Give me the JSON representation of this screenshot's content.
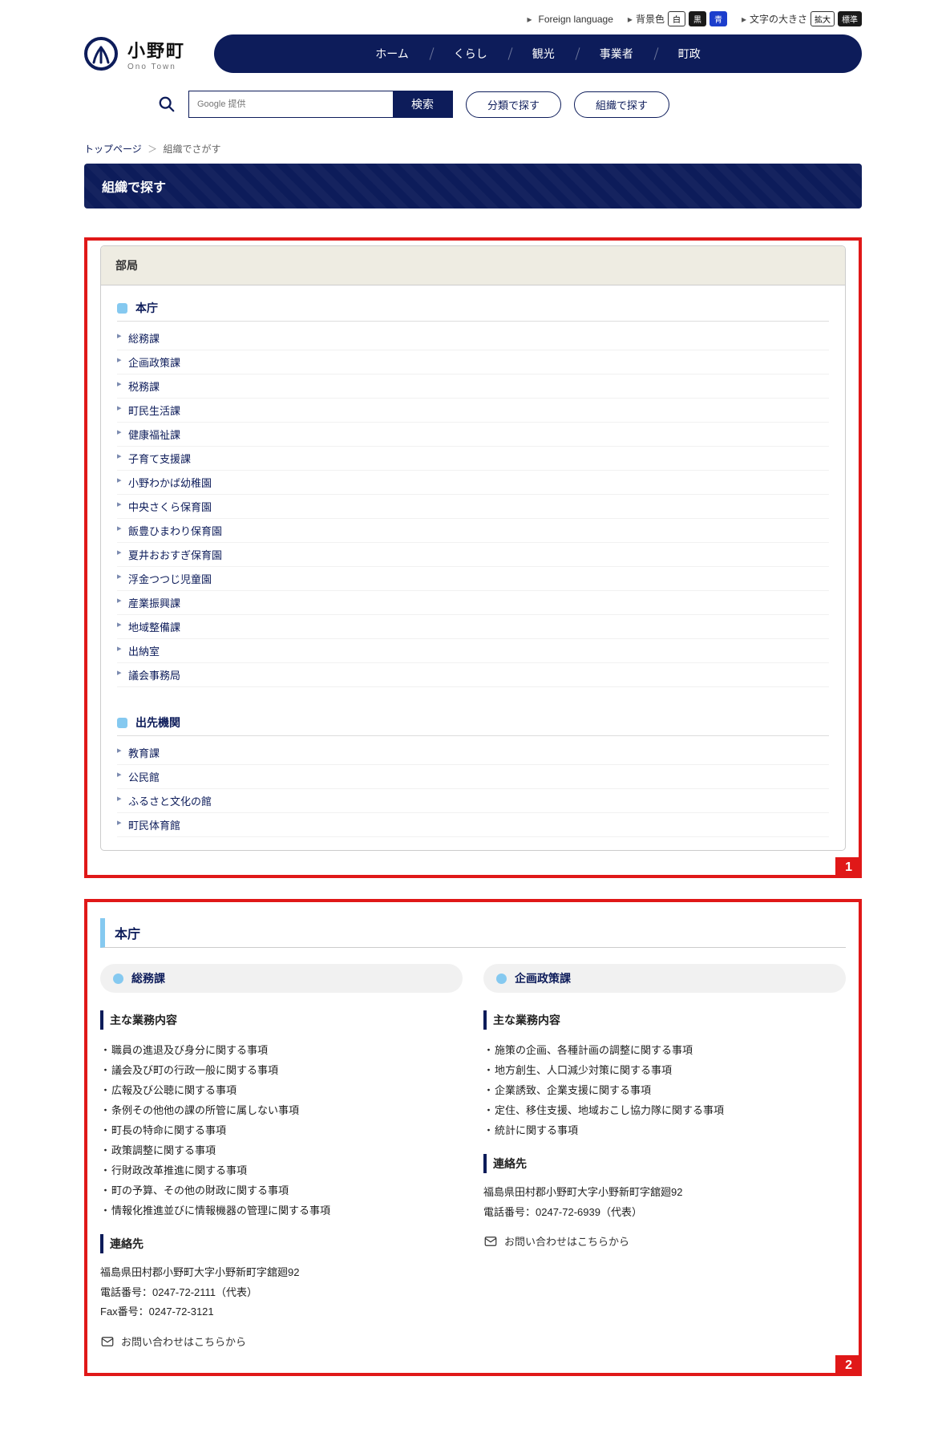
{
  "topbar": {
    "foreign": "Foreign language",
    "bgcolor_label": "背景色",
    "bg_white": "白",
    "bg_black": "黒",
    "bg_blue": "青",
    "fontsize_label": "文字の大きさ",
    "font_large": "拡大",
    "font_std": "標準"
  },
  "logo": {
    "jp": "小野町",
    "en": "Ono Town"
  },
  "nav": [
    "ホーム",
    "くらし",
    "観光",
    "事業者",
    "町政"
  ],
  "search": {
    "placeholder": "Google 提供",
    "button": "検索",
    "by_category": "分類で探す",
    "by_org": "組織で探す"
  },
  "crumbs": {
    "home": "トップページ",
    "current": "組織でさがす"
  },
  "page_title": "組織で探す",
  "region1": {
    "tag": "1",
    "card_head": "部局",
    "sections": [
      {
        "title": "本庁",
        "items": [
          "総務課",
          "企画政策課",
          "税務課",
          "町民生活課",
          "健康福祉課",
          "子育て支援課",
          "小野わかば幼稚園",
          "中央さくら保育園",
          "飯豊ひまわり保育園",
          "夏井おおすぎ保育園",
          "浮金つつじ児童園",
          "産業振興課",
          "地域整備課",
          "出納室",
          "議会事務局"
        ]
      },
      {
        "title": "出先機関",
        "items": [
          "教育課",
          "公民館",
          "ふるさと文化の館",
          "町民体育館"
        ]
      }
    ]
  },
  "region2": {
    "tag": "2",
    "section_title": "本庁",
    "cols": [
      {
        "head": "総務課",
        "duties_title": "主な業務内容",
        "duties": [
          "職員の進退及び身分に関する事項",
          "議会及び町の行政一般に関する事項",
          "広報及び公聴に関する事項",
          "条例その他他の課の所管に属しない事項",
          "町長の特命に関する事項",
          "政策調整に関する事項",
          "行財政改革推進に関する事項",
          "町の予算、その他の財政に関する事項",
          "情報化推進並びに情報機器の管理に関する事項"
        ],
        "contact_title": "連絡先",
        "address": [
          "福島県田村郡小野町大字小野新町字舘廻92",
          "電話番号：0247-72-2111（代表）",
          "Fax番号：0247-72-3121"
        ],
        "mail": "お問い合わせはこちらから"
      },
      {
        "head": "企画政策課",
        "duties_title": "主な業務内容",
        "duties": [
          "施策の企画、各種計画の調整に関する事項",
          "地方創生、人口減少対策に関する事項",
          "企業誘致、企業支援に関する事項",
          "定住、移住支援、地域おこし協力隊に関する事項",
          "統計に関する事項"
        ],
        "contact_title": "連絡先",
        "address": [
          "福島県田村郡小野町大字小野新町字舘廻92",
          "電話番号：0247-72-6939（代表）"
        ],
        "mail": "お問い合わせはこちらから"
      }
    ]
  }
}
